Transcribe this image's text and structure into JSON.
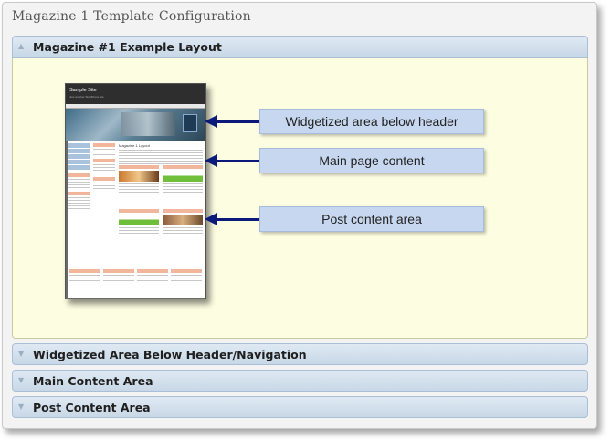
{
  "window": {
    "title": "Magazine 1 Template Configuration"
  },
  "accordion": [
    {
      "label": "Magazine #1 Example Layout",
      "expanded": true,
      "arrow": "▲"
    },
    {
      "label": "Widgetized Area Below Header/Navigation",
      "expanded": false,
      "arrow": "▼"
    },
    {
      "label": "Main Content Area",
      "expanded": false,
      "arrow": "▼"
    },
    {
      "label": "Post Content Area",
      "expanded": false,
      "arrow": "▼"
    }
  ],
  "preview": {
    "site_title": "Sample Site",
    "site_tagline": "Just another WordPress site",
    "main_heading": "Magazine 1 Layout"
  },
  "callouts": [
    {
      "text": "Widgetized area below header"
    },
    {
      "text": "Main page content"
    },
    {
      "text": "Post content area"
    }
  ],
  "colors": {
    "header_gradient_top": "#dfe9f3",
    "header_gradient_bottom": "#c9d8e7",
    "panel_background": "#fdfde1",
    "callout_background": "#c6d7ef",
    "arrow": "#0b1a7a"
  }
}
